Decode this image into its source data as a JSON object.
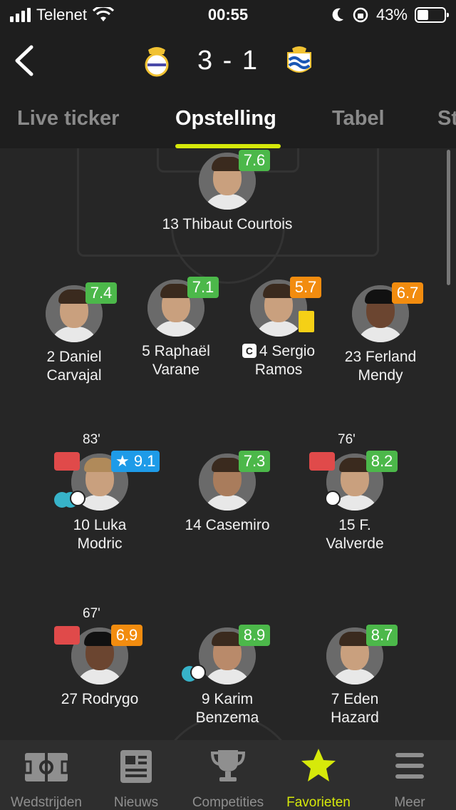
{
  "status_bar": {
    "carrier": "Telenet",
    "time": "00:55",
    "battery": "43%",
    "battery_level": 0.43,
    "icons": [
      "signal-icon",
      "wifi-icon",
      "moon-icon",
      "orientation-lock-icon",
      "battery-icon"
    ]
  },
  "match": {
    "score": "3 - 1",
    "home_crest": "real-madrid-crest-icon",
    "away_crest": "real-sociedad-crest-icon"
  },
  "tabs": [
    {
      "label": "Live ticker"
    },
    {
      "label": "Opstelling",
      "active": true
    },
    {
      "label": "Tabel"
    },
    {
      "label": "St"
    }
  ],
  "players": [
    {
      "name": "13 Thibaut Courtois",
      "rating": "7.6",
      "rating_color": "green"
    },
    {
      "name": "2 Daniel Carvajal",
      "rating": "7.4",
      "rating_color": "green"
    },
    {
      "name": "5 Raphaël Varane",
      "rating": "7.1",
      "rating_color": "green"
    },
    {
      "name": "4 Sergio Ramos",
      "rating": "5.7",
      "rating_color": "orange",
      "captain_badge": "C",
      "yellow_card": true
    },
    {
      "name": "23 Ferland Mendy",
      "rating": "6.7",
      "rating_color": "orange"
    },
    {
      "name": "10 Luka Modric",
      "rating": "★ 9.1",
      "rating_color": "blue",
      "sub_minute": "83'"
    },
    {
      "name": "14 Casemiro",
      "rating": "7.3",
      "rating_color": "green"
    },
    {
      "name": "15 F. Valverde",
      "rating": "8.2",
      "rating_color": "green",
      "sub_minute": "76'"
    },
    {
      "name": "27 Rodrygo",
      "rating": "6.9",
      "rating_color": "orange",
      "sub_minute": "67'"
    },
    {
      "name": "9 Karim Benzema",
      "rating": "8.9",
      "rating_color": "green"
    },
    {
      "name": "7 Eden Hazard",
      "rating": "8.7",
      "rating_color": "green"
    }
  ],
  "nav": [
    {
      "label": "Wedstrijden",
      "icon": "pitch-icon"
    },
    {
      "label": "Nieuws",
      "icon": "news-icon"
    },
    {
      "label": "Competities",
      "icon": "trophy-icon"
    },
    {
      "label": "Favorieten",
      "icon": "star-icon",
      "active": true
    },
    {
      "label": "Meer",
      "icon": "menu-icon"
    }
  ],
  "colors": {
    "accent": "#d6e90a",
    "rating_green": "#4cb84a",
    "rating_orange": "#f28c0f",
    "rating_blue": "#1e9be8",
    "sub_out": "#e04a4a",
    "yellow_card": "#f5d016"
  }
}
